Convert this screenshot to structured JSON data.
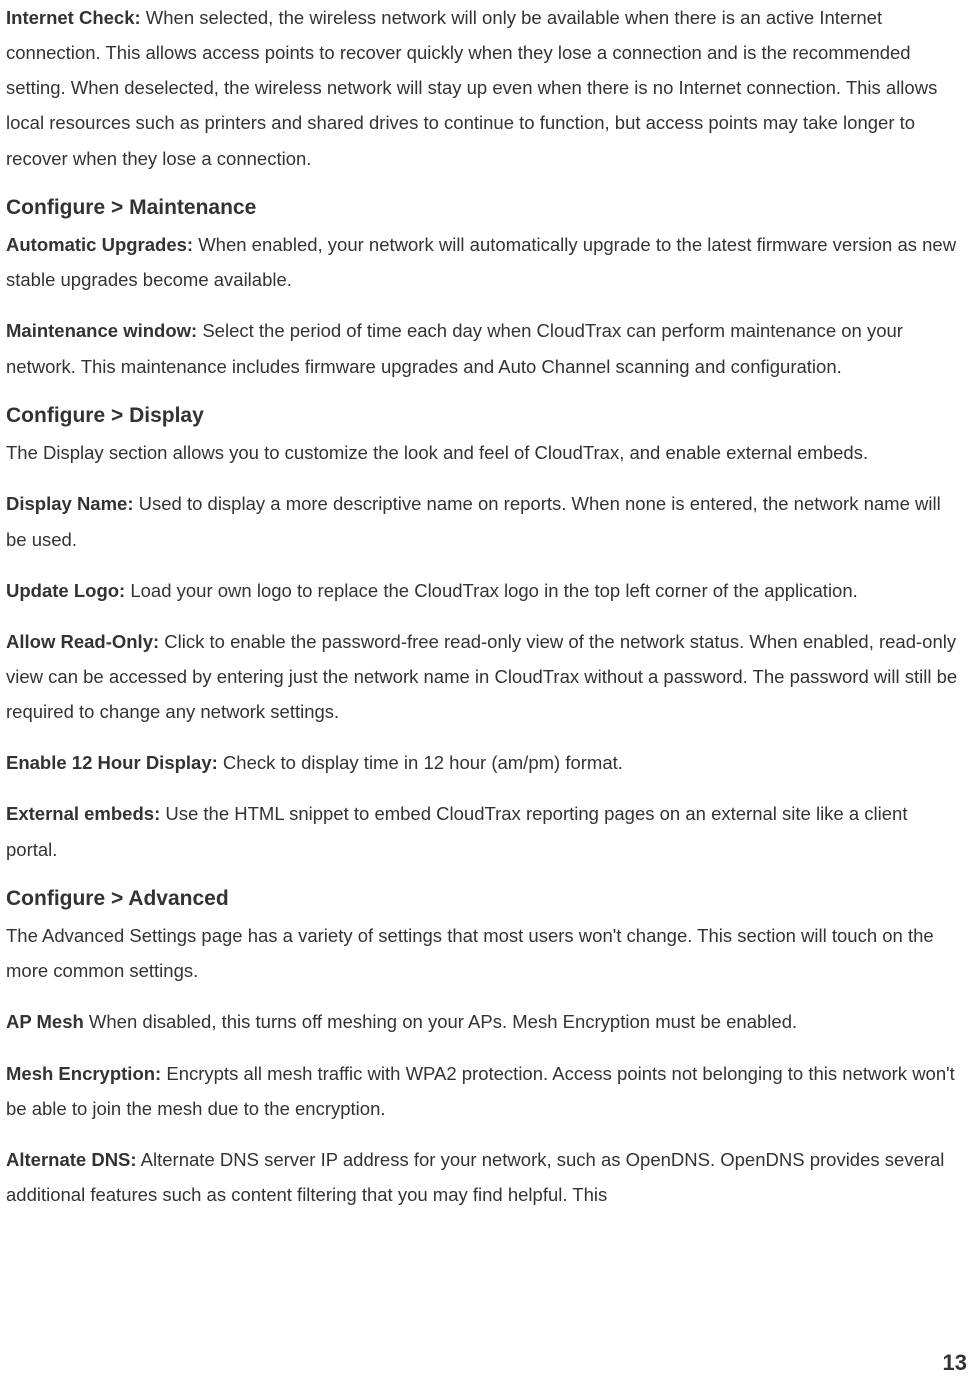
{
  "paragraphs": {
    "internet_check_label": "Internet Check:",
    "internet_check_text": " When selected, the wireless network will only be available when there is an active Internet connection. This allows access points to recover quickly when they lose a connection and is the recommended setting. When deselected, the wireless network will stay up even when there is no Internet connection. This allows local resources such as printers and shared drives to continue to function, but access points may take longer to recover when they lose a connection.",
    "configure_maintenance_heading": "Configure > Maintenance",
    "automatic_upgrades_label": "Automatic Upgrades:",
    "automatic_upgrades_text": " When enabled, your network will automatically upgrade to the latest firmware version as new stable upgrades become available.",
    "maintenance_window_label": "Maintenance window:",
    "maintenance_window_text": " Select the period of time each day when CloudTrax can perform maintenance on your network. This maintenance includes firmware upgrades and Auto Channel scanning and configuration.",
    "configure_display_heading": "Configure > Display",
    "display_intro": "The Display section allows you to customize the look and feel of CloudTrax, and enable external embeds.",
    "display_name_label": "Display Name:",
    "display_name_text": " Used to display a more descriptive name on reports. When none is entered, the network name will be used.",
    "update_logo_label": "Update Logo:",
    "update_logo_text": " Load your own logo to replace the CloudTrax logo in the top left corner of the application.",
    "allow_readonly_label": "Allow Read-Only:",
    "allow_readonly_text": " Click to enable the password-free read-only view of the network status. When enabled, read-only view can be accessed by entering just the network name in CloudTrax without a password. The password will still be required to change any network settings.",
    "enable_12hour_label": "Enable 12 Hour Display:",
    "enable_12hour_text": " Check to display time in 12 hour (am/pm) format.",
    "external_embeds_label": "External embeds:",
    "external_embeds_text": " Use the HTML snippet to embed CloudTrax reporting pages on an external site like a client portal.",
    "configure_advanced_heading": "Configure > Advanced",
    "advanced_intro": "The Advanced Settings page has a variety of settings that most users won't change. This section will touch on the more common settings.",
    "ap_mesh_label": "AP Mesh",
    "ap_mesh_text": " When disabled, this turns off meshing on your APs. Mesh Encryption must be enabled.",
    "mesh_encryption_label": "Mesh Encryption:",
    "mesh_encryption_text": " Encrypts all mesh traffic with WPA2 protection. Access points not belonging to this network won't be able to join the mesh due to the encryption.",
    "alternate_dns_label": "Alternate DNS:",
    "alternate_dns_text": " Alternate DNS server IP address for your network, such as OpenDNS. OpenDNS provides several additional features such as content filtering that you may find helpful. This"
  },
  "page_number": "13"
}
